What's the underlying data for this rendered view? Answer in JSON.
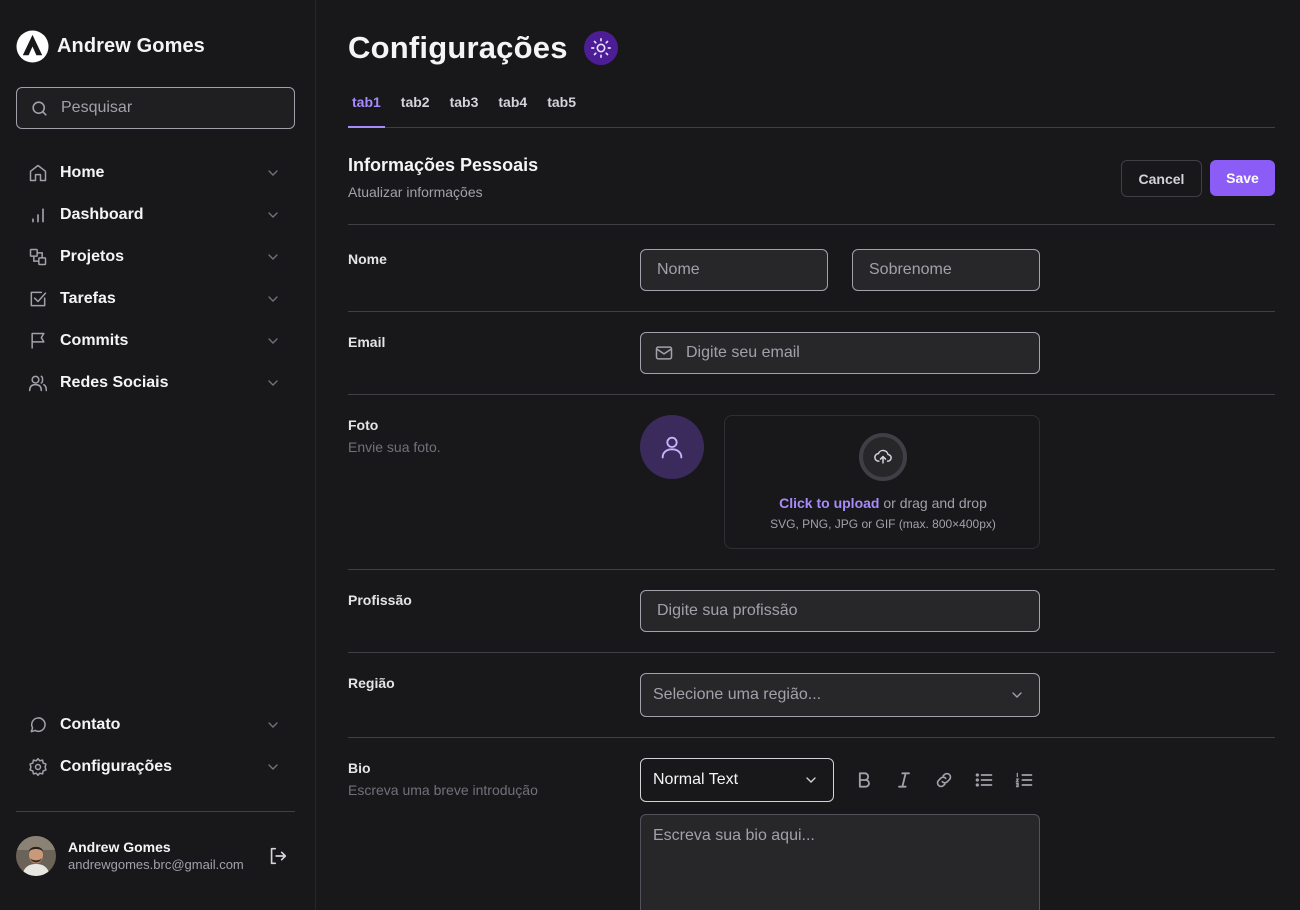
{
  "sidebar": {
    "brand": "Andrew Gomes",
    "search_placeholder": "Pesquisar",
    "items": [
      {
        "label": "Home",
        "icon": "home-icon"
      },
      {
        "label": "Dashboard",
        "icon": "bar-chart-icon"
      },
      {
        "label": "Projetos",
        "icon": "projects-icon"
      },
      {
        "label": "Tarefas",
        "icon": "check-square-icon"
      },
      {
        "label": "Commits",
        "icon": "flag-icon"
      },
      {
        "label": "Redes Sociais",
        "icon": "users-icon"
      }
    ],
    "bottom_items": [
      {
        "label": "Contato",
        "icon": "message-circle-icon"
      },
      {
        "label": "Configurações",
        "icon": "gear-icon"
      }
    ],
    "profile": {
      "name": "Andrew Gomes",
      "email": "andrewgomes.brc@gmail.com"
    }
  },
  "header": {
    "title": "Configurações"
  },
  "tabs": [
    "tab1",
    "tab2",
    "tab3",
    "tab4",
    "tab5"
  ],
  "active_tab": "tab1",
  "section": {
    "title": "Informações Pessoais",
    "subtitle": "Atualizar informações",
    "cancel_label": "Cancel",
    "save_label": "Save"
  },
  "form": {
    "nome": {
      "label": "Nome",
      "first_placeholder": "Nome",
      "last_placeholder": "Sobrenome"
    },
    "email": {
      "label": "Email",
      "placeholder": "Digite seu email"
    },
    "foto": {
      "label": "Foto",
      "hint": "Envie sua foto.",
      "upload_link": "Click to upload",
      "upload_text": " or drag and drop",
      "upload_hint": "SVG, PNG, JPG or GIF (max. 800×400px)"
    },
    "profissao": {
      "label": "Profissão",
      "placeholder": "Digite sua profissão"
    },
    "regiao": {
      "label": "Região",
      "placeholder": "Selecione uma região..."
    },
    "bio": {
      "label": "Bio",
      "hint": "Escreva uma breve introdução",
      "format": "Normal Text",
      "placeholder": "Escreva sua bio aqui..."
    }
  },
  "colors": {
    "background": "#18181b",
    "accent": "#8b5cf6",
    "accent_light": "#a78bfa"
  }
}
